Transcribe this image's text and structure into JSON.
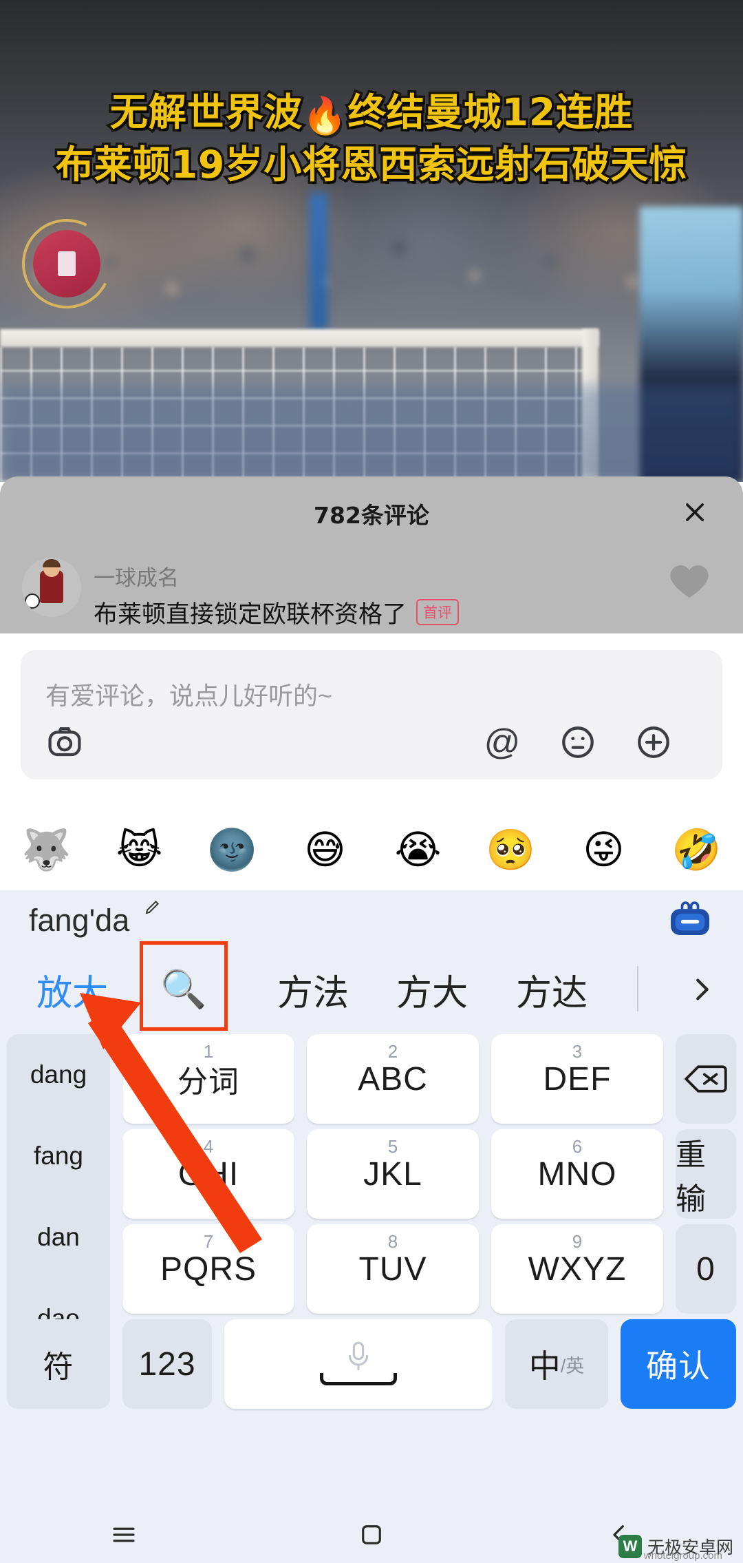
{
  "video": {
    "title_line1": "无解世界波",
    "title_fire": "🔥",
    "title_line1b": "终结曼城12连胜",
    "title_line2": "布莱顿19岁小将恩西索远射石破天惊"
  },
  "comment_panel": {
    "title": "782条评论",
    "close_icon": "close-icon",
    "comment": {
      "author": "一球成名",
      "text": "布莱顿直接锁定欧联杯资格了",
      "badge": "首评",
      "like_icon": "heart-icon"
    }
  },
  "input_bar": {
    "placeholder": "有爱评论，说点儿好听的~",
    "value": "",
    "icons": {
      "camera": "camera-icon",
      "mention": "@",
      "emoji": "emoji-face-icon",
      "more": "plus-circle-icon"
    }
  },
  "emoji_strip": {
    "items": [
      "🐺",
      "😹",
      "🌚",
      "😅",
      "😭",
      "🥺",
      "😜",
      "🤣"
    ]
  },
  "keyboard": {
    "composing_pinyin": "fang'da",
    "edit_icon": "pencil-icon",
    "sticker_icon": "sticker-bag-icon",
    "candidates": [
      {
        "label": "放大",
        "selected": true
      },
      {
        "label": "🔍",
        "selected": false,
        "highlighted": true,
        "icon": "magnifier-icon"
      },
      {
        "label": "方法",
        "selected": false
      },
      {
        "label": "方大",
        "selected": false
      },
      {
        "label": "方达",
        "selected": false
      }
    ],
    "expand_icon": "chevron-right-icon",
    "syllables": [
      "dang",
      "fang",
      "dan",
      "dao"
    ],
    "keys": [
      {
        "num": "1",
        "label": "分词"
      },
      {
        "num": "2",
        "label": "ABC"
      },
      {
        "num": "3",
        "label": "DEF"
      },
      {
        "num": "4",
        "label": "GHI"
      },
      {
        "num": "5",
        "label": "JKL"
      },
      {
        "num": "6",
        "label": "MNO"
      },
      {
        "num": "7",
        "label": "PQRS"
      },
      {
        "num": "8",
        "label": "TUV"
      },
      {
        "num": "9",
        "label": "WXYZ"
      }
    ],
    "side_keys": {
      "backspace": "backspace-icon",
      "redo": "重输",
      "zero": "0"
    },
    "bottom_keys": {
      "symbol": "符",
      "numbers": "123",
      "space_icon": "microphone-icon",
      "lang_main": "中",
      "lang_sub": "/英",
      "confirm": "确认"
    }
  },
  "nav_bar": {
    "recents_icon": "menu-icon",
    "home_icon": "home-square-icon",
    "back_icon": "back-chevron-icon"
  },
  "watermark": {
    "logo": "W",
    "name": "无极安卓网",
    "url": "whotelgroup.com"
  },
  "colors": {
    "accent_blue": "#1a7df5",
    "annotation_red": "#f03c0e",
    "title_yellow": "#f1c40f",
    "badge_red": "#e8506a"
  }
}
